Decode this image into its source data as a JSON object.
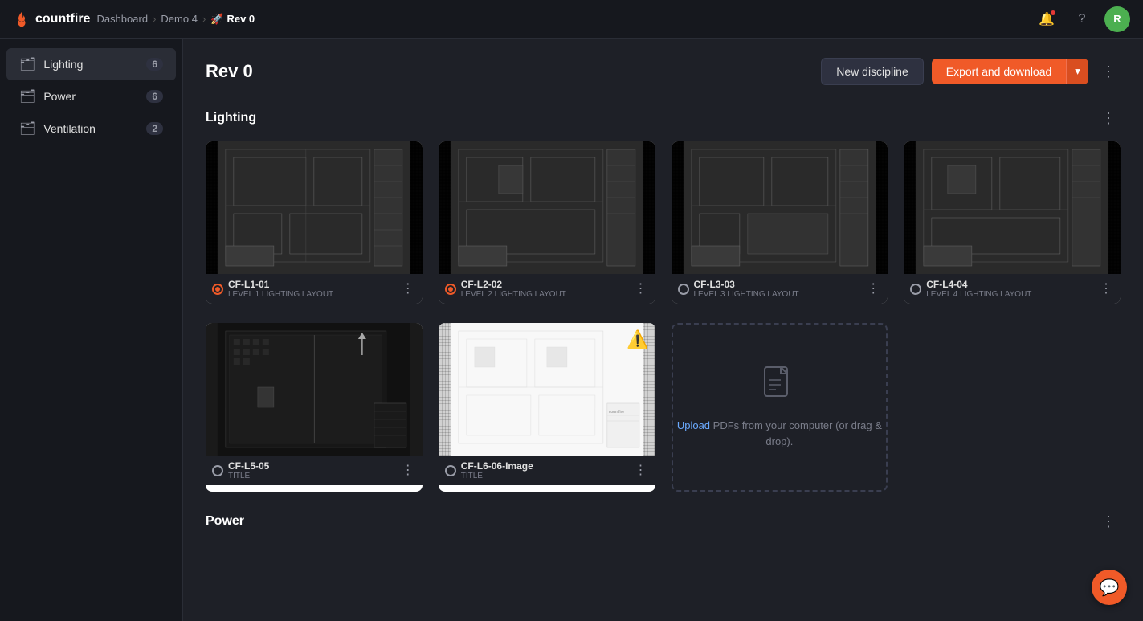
{
  "topnav": {
    "brand": "countfire",
    "breadcrumb": {
      "items": [
        "Dashboard",
        "Demo 4"
      ],
      "current": "Rev 0",
      "icon": "rocket"
    },
    "notifications_label": "notifications",
    "help_label": "help",
    "avatar_initials": "R"
  },
  "sidebar": {
    "items": [
      {
        "id": "lighting",
        "label": "Lighting",
        "count": "6",
        "icon": "folder"
      },
      {
        "id": "power",
        "label": "Power",
        "count": "6",
        "icon": "folder"
      },
      {
        "id": "ventilation",
        "label": "Ventilation",
        "count": "2",
        "icon": "folder"
      }
    ]
  },
  "page": {
    "title": "Rev 0",
    "actions": {
      "new_discipline_label": "New discipline",
      "export_label": "Export and download"
    }
  },
  "sections": [
    {
      "id": "lighting",
      "title": "Lighting",
      "cards": [
        {
          "id": "cf-l1-01",
          "name": "CF-L1-01",
          "subtitle": "LEVEL 1 LIGHTING LAYOUT",
          "status": "active",
          "theme": "dark"
        },
        {
          "id": "cf-l2-02",
          "name": "CF-L2-02",
          "subtitle": "LEVEL 2 LIGHTING LAYOUT",
          "status": "active",
          "theme": "dark"
        },
        {
          "id": "cf-l3-03",
          "name": "CF-L3-03",
          "subtitle": "LEVEL 3 LIGHTING LAYOUT",
          "status": "inactive",
          "theme": "dark"
        },
        {
          "id": "cf-l4-04",
          "name": "CF-L4-04",
          "subtitle": "LEVEL 4 LIGHTING LAYOUT",
          "status": "inactive",
          "theme": "dark"
        },
        {
          "id": "cf-l5-05",
          "name": "CF-L5-05",
          "subtitle": "Title",
          "status": "inactive",
          "theme": "dark"
        },
        {
          "id": "cf-l6-06",
          "name": "CF-L6-06-Image",
          "subtitle": "Title",
          "status": "inactive",
          "theme": "light",
          "warning": true
        }
      ]
    },
    {
      "id": "power",
      "title": "Power",
      "cards": []
    }
  ],
  "upload": {
    "link_label": "Upload",
    "text": " PDFs from your computer (or drag & drop)."
  },
  "icons": {
    "more_vert": "⋮",
    "chevron_down": "▾",
    "folder": "🗂",
    "rocket": "🚀",
    "warning": "⚠️",
    "chat": "💬",
    "file": "📄"
  }
}
